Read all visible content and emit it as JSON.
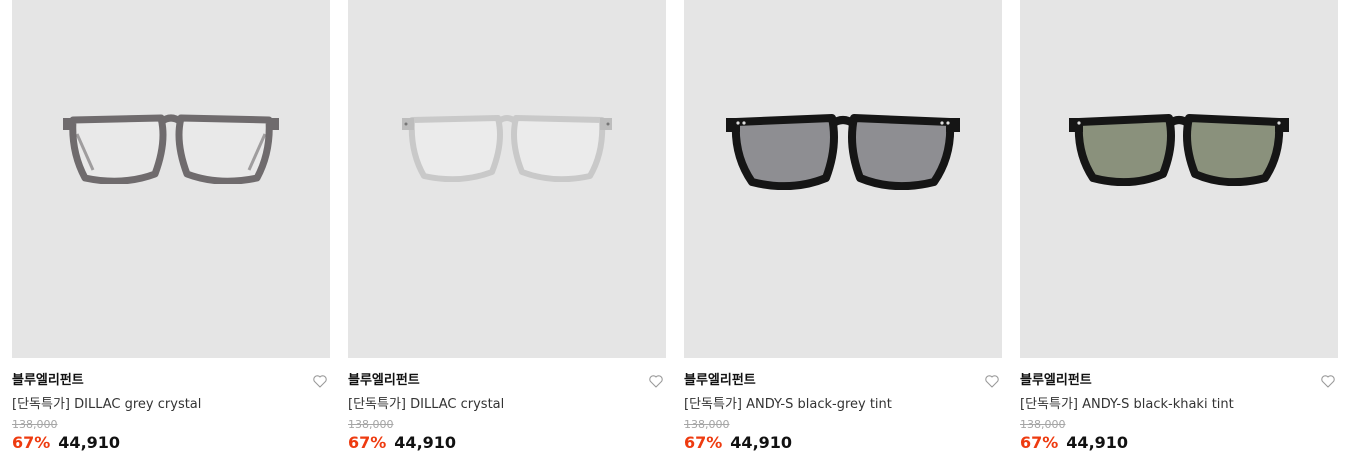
{
  "products": [
    {
      "brand": "블루엘리펀트",
      "name": "[단독특가] DILLAC grey crystal",
      "original_price": "138,000",
      "discount": "67%",
      "price": "44,910",
      "frame_color": "#6f6b6d",
      "lens_color": "none",
      "image": "glasses-grey-crystal-image",
      "wishlist_icon": "heart-outline-icon"
    },
    {
      "brand": "블루엘리펀트",
      "name": "[단독특가] DILLAC crystal",
      "original_price": "138,000",
      "discount": "67%",
      "price": "44,910",
      "frame_color": "#c9c9c9",
      "lens_color": "none",
      "image": "glasses-clear-crystal-image",
      "wishlist_icon": "heart-outline-icon"
    },
    {
      "brand": "블루엘리펀트",
      "name": "[단독특가] ANDY-S black-grey tint",
      "original_price": "138,000",
      "discount": "67%",
      "price": "44,910",
      "frame_color": "#151515",
      "lens_color": "#8e8e92",
      "image": "sunglasses-black-grey-image",
      "wishlist_icon": "heart-outline-icon"
    },
    {
      "brand": "블루엘리펀트",
      "name": "[단독특가] ANDY-S black-khaki tint",
      "original_price": "138,000",
      "discount": "67%",
      "price": "44,910",
      "frame_color": "#151515",
      "lens_color": "#8a917c",
      "image": "sunglasses-black-khaki-image",
      "wishlist_icon": "heart-outline-icon"
    }
  ],
  "colors": {
    "discount": "#ee3b10",
    "thumb_bg": "#e5e5e5",
    "original_price": "#a6a6a6"
  }
}
